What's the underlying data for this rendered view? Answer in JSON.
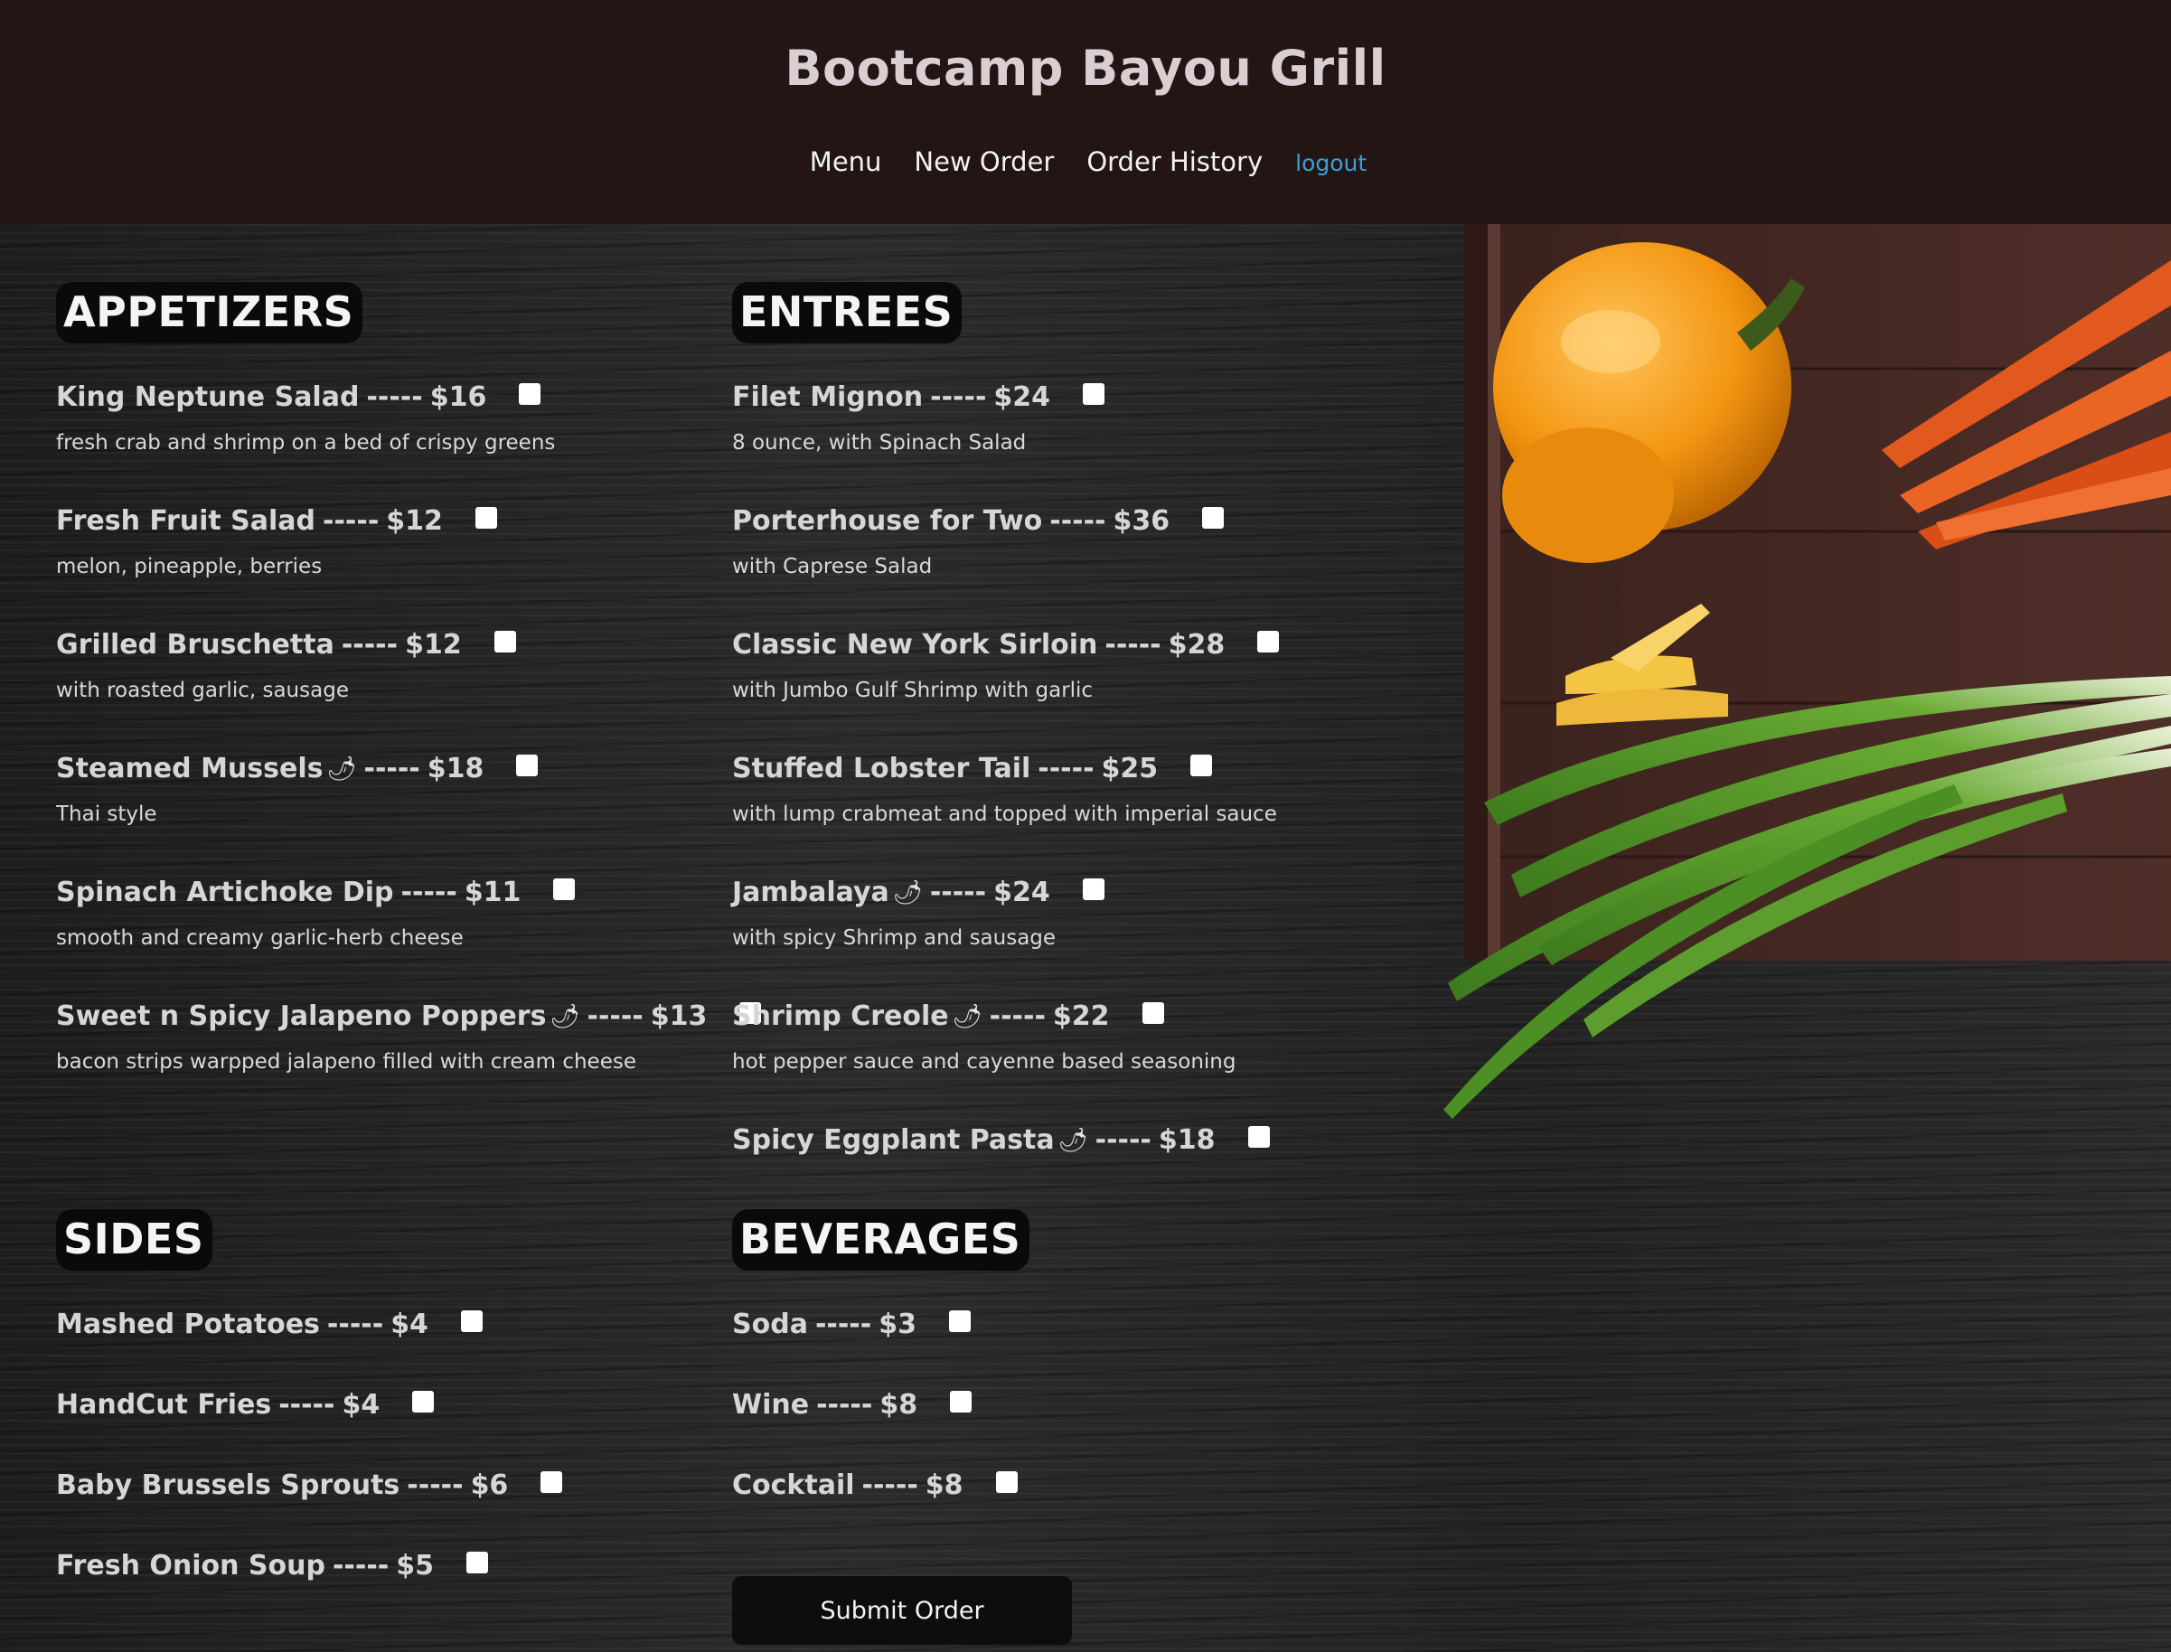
{
  "header": {
    "title": "Bootcamp Bayou Grill",
    "nav": {
      "menu": "Menu",
      "new_order": "New Order",
      "order_history": "Order History",
      "logout": "logout"
    }
  },
  "menu": {
    "appetizers": {
      "heading": "APPETIZERS",
      "items": [
        {
          "name": "King Neptune Salad",
          "sep": "-----",
          "price": "$16",
          "desc": "fresh crab and shrimp on a bed of crispy greens",
          "spicy": false
        },
        {
          "name": "Fresh Fruit Salad",
          "sep": "-----",
          "price": "$12",
          "desc": "melon, pineapple, berries",
          "spicy": false
        },
        {
          "name": "Grilled Bruschetta",
          "sep": "-----",
          "price": "$12",
          "desc": "with roasted garlic, sausage",
          "spicy": false
        },
        {
          "name": "Steamed Mussels",
          "sep": "-----",
          "price": "$18",
          "desc": "Thai style",
          "spicy": true
        },
        {
          "name": "Spinach Artichoke Dip",
          "sep": "-----",
          "price": "$11",
          "desc": "smooth and creamy garlic-herb cheese",
          "spicy": false
        },
        {
          "name": "Sweet n Spicy Jalapeno Poppers",
          "sep": "-----",
          "price": "$13",
          "desc": "bacon strips warpped jalapeno filled with cream cheese",
          "spicy": true
        }
      ]
    },
    "entrees": {
      "heading": "ENTREES",
      "items": [
        {
          "name": "Filet Mignon",
          "sep": "-----",
          "price": "$24",
          "desc": "8 ounce, with Spinach Salad",
          "spicy": false
        },
        {
          "name": "Porterhouse for Two",
          "sep": "-----",
          "price": "$36",
          "desc": "with Caprese Salad",
          "spicy": false
        },
        {
          "name": "Classic New York Sirloin",
          "sep": "-----",
          "price": "$28",
          "desc": "with Jumbo Gulf Shrimp with garlic",
          "spicy": false
        },
        {
          "name": "Stuffed Lobster Tail",
          "sep": "-----",
          "price": "$25",
          "desc": "with lump crabmeat and topped with imperial sauce",
          "spicy": false
        },
        {
          "name": "Jambalaya",
          "sep": "-----",
          "price": "$24",
          "desc": "with spicy Shrimp and sausage",
          "spicy": true
        },
        {
          "name": "Shrimp Creole",
          "sep": "-----",
          "price": "$22",
          "desc": "hot pepper sauce and cayenne based seasoning",
          "spicy": true
        },
        {
          "name": "Spicy Eggplant Pasta",
          "sep": "-----",
          "price": "$18",
          "desc": "",
          "spicy": true
        }
      ]
    },
    "sides": {
      "heading": "SIDES",
      "items": [
        {
          "name": "Mashed Potatoes",
          "sep": "-----",
          "price": "$4",
          "desc": "",
          "spicy": false
        },
        {
          "name": "HandCut Fries",
          "sep": "-----",
          "price": "$4",
          "desc": "",
          "spicy": false
        },
        {
          "name": "Baby Brussels Sprouts",
          "sep": "-----",
          "price": "$6",
          "desc": "",
          "spicy": false
        },
        {
          "name": "Fresh Onion Soup",
          "sep": "-----",
          "price": "$5",
          "desc": "",
          "spicy": false
        }
      ]
    },
    "beverages": {
      "heading": "BEVERAGES",
      "items": [
        {
          "name": "Soda",
          "sep": "-----",
          "price": "$3",
          "desc": "",
          "spicy": false
        },
        {
          "name": "Wine",
          "sep": "-----",
          "price": "$8",
          "desc": "",
          "spicy": false
        },
        {
          "name": "Cocktail",
          "sep": "-----",
          "price": "$8",
          "desc": "",
          "spicy": false
        }
      ]
    }
  },
  "spicy_icon": "chili-pepper-icon",
  "submit_label": "Submit Order"
}
